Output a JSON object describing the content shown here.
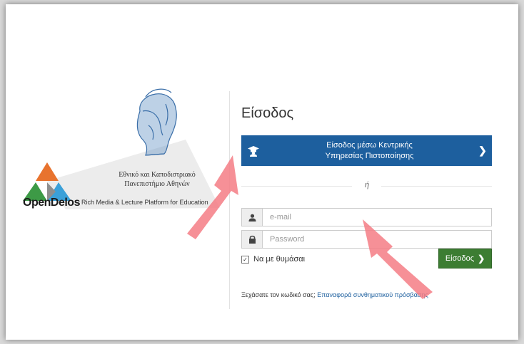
{
  "branding": {
    "university_line1": "Εθνικό και Καποδιστριακό",
    "university_line2": "Πανεπιστήμιο Αθηνών",
    "app_name": "OpenDelos",
    "tagline": "Rich Media & Lecture Platform for Education"
  },
  "login": {
    "title": "Είσοδος",
    "sso_line1": "Είσοδος μέσω Κεντρικής",
    "sso_line2": "Υπηρεσίας Πιστοποίησης",
    "or_text": "ή",
    "email_placeholder": "e-mail",
    "password_placeholder": "Password",
    "email_value": "",
    "password_value": "",
    "remember_label": "Να με θυμάσαι",
    "remember_checked": true,
    "submit_label": "Είσοδος",
    "forgot_text": "Ξεχάσατε τον κωδικό σας;",
    "reset_link": "Επαναφορά συνθηματικού πρόσβασης"
  },
  "icons": {
    "sso": "graduation-cap-icon",
    "sso_arrow": "chevron-right-icon",
    "email": "user-icon",
    "password": "lock-icon",
    "submit_arrow": "chevron-right-icon"
  },
  "colors": {
    "sso_button": "#1d5f9e",
    "login_button": "#3c7d32",
    "link": "#1d5f9e",
    "annotation_arrow": "#f47c85"
  }
}
